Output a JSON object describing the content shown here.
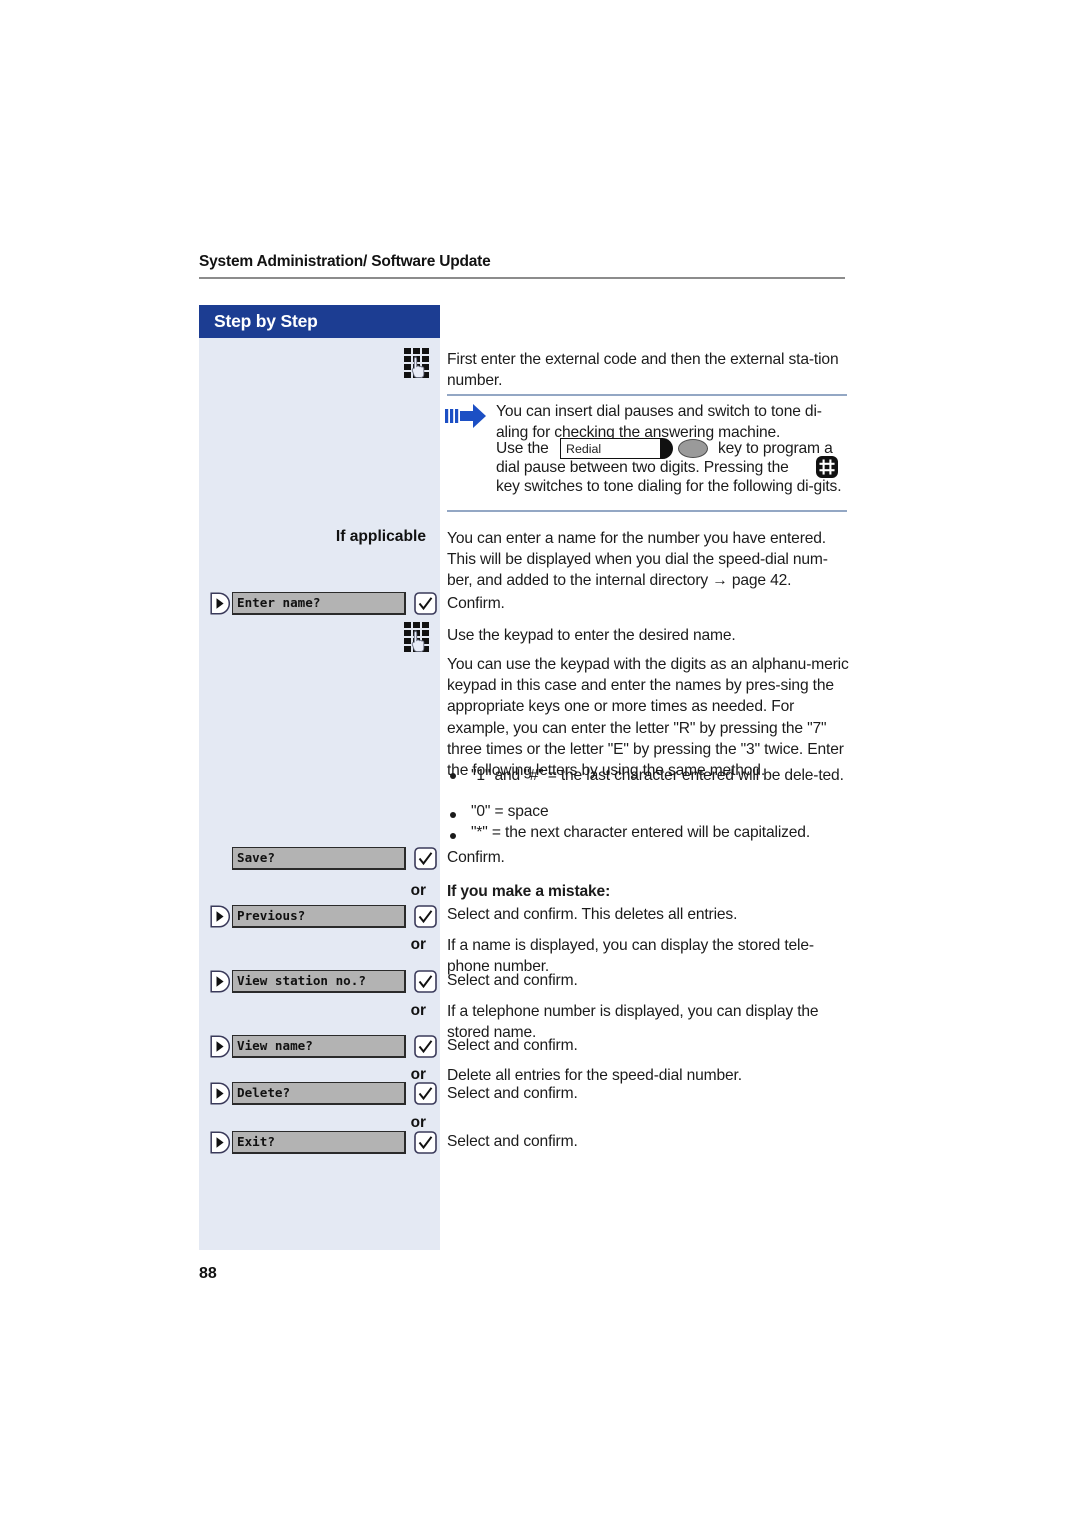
{
  "document": {
    "running_head": "System Administration/ Software Update",
    "page_number": "88"
  },
  "sidebar": {
    "banner_label": "Step by Step",
    "if_applicable_label": "If applicable",
    "or_label": "or",
    "display_keys": [
      {
        "label": "Enter name?",
        "has_marker": true,
        "confirm": true
      },
      {
        "label": "Save?",
        "has_marker": false,
        "confirm": true
      },
      {
        "label": "Previous?",
        "has_marker": true,
        "confirm": true
      },
      {
        "label": "View station no.?",
        "has_marker": true,
        "confirm": true
      },
      {
        "label": "View name?",
        "has_marker": true,
        "confirm": true
      },
      {
        "label": "Delete?",
        "has_marker": true,
        "confirm": true
      },
      {
        "label": "Exit?",
        "has_marker": true,
        "confirm": true
      }
    ]
  },
  "main": {
    "step_keypad_intro": "First enter the external code and then the external sta-tion number.",
    "note": {
      "line1": "You can insert dial pauses and switch to tone di-aling for checking the answering machine.",
      "use_the": "Use the",
      "redial_key_label": "Redial",
      "after_key": "key to program a",
      "line3": "dial pause between two digits. Pressing the",
      "hash_key_glyph": "#",
      "line4": "key switches to tone dialing for the following di-gits."
    },
    "if_applicable_body": "You can enter a name for the number you have entered. This will be displayed when you dial the speed-dial num-ber, and added to the internal directory → page 42.",
    "confirm_1": "Confirm.",
    "use_keypad": "Use the keypad to enter the desired name.",
    "alphanumeric_body": "You can use the keypad with the digits as an alphanu-meric keypad in this case and enter the names by pres-sing the appropriate keys one or more times as needed. For example, you can enter the letter \"R\" by pressing the \"7\" three times or the letter \"E\" by pressing the \"3\" twice. Enter the following letters by using the same method.",
    "bullets": [
      "\"1\" and \"#\" = the last character entered will be dele-ted.",
      "\"0\" = space",
      "\"*\" = the next character entered will be capitalized."
    ],
    "confirm_2": "Confirm.",
    "mistake_heading": "If you make a mistake:",
    "previous_body": "Select and confirm. This deletes all entries.",
    "view_station_intro": "If a name is displayed, you can display the stored tele-phone number.",
    "view_station_action": "Select and confirm.",
    "view_name_intro": "If a telephone number is displayed, you can display the stored name.",
    "view_name_action": "Select and confirm.",
    "delete_intro": "Delete all entries for the speed-dial number.",
    "delete_action": "Select and confirm.",
    "exit_action": "Select and confirm."
  },
  "colors": {
    "banner_blue": "#1c3d92",
    "sidebar_bg": "#e4e9f3",
    "rule_blue": "#93a7c4",
    "key_gray": "#b3b3b3",
    "arrow_blue": "#1c4fc4"
  }
}
